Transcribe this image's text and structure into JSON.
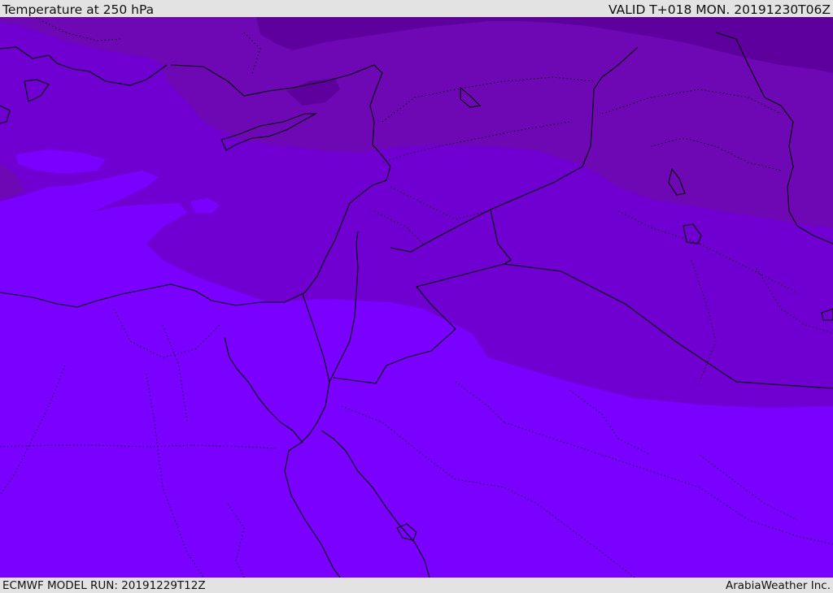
{
  "header": {
    "title": "Temperature at 250 hPa",
    "valid": "VALID T+018 MON. 20191230T06Z"
  },
  "footer": {
    "model_run": "ECMWF MODEL RUN: 20191229T12Z",
    "brand": "ArabiaWeather Inc."
  },
  "colors": {
    "coldest": "#5e009e",
    "cold": "#6d08b4",
    "mid": "#7000d2",
    "warm": "#7a00ff",
    "coast": "#000000"
  }
}
